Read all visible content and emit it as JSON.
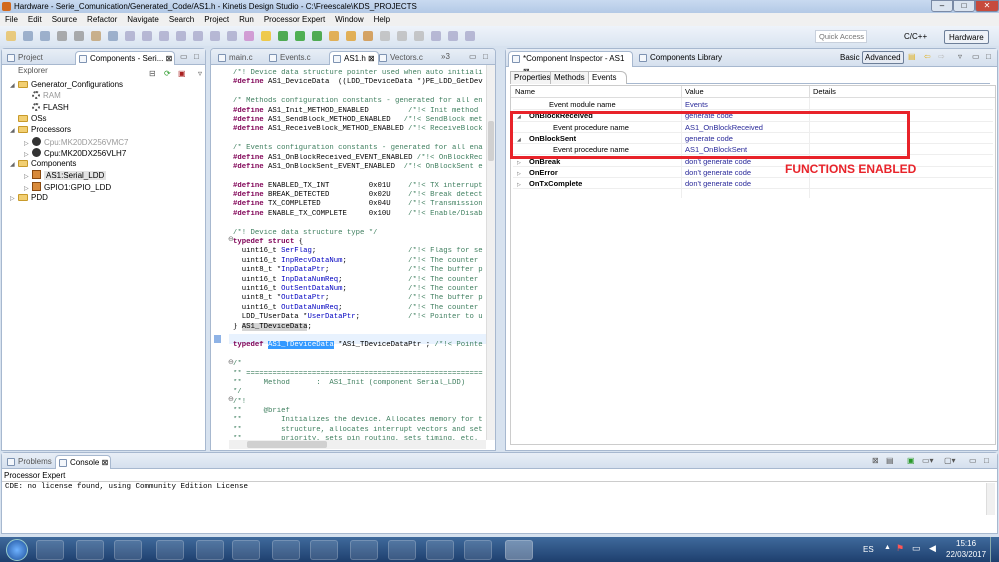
{
  "window": {
    "title": "Hardware - Serie_Comunication/Generated_Code/AS1.h - Kinetis Design Studio - C:\\Freescale\\KDS_PROJECTS",
    "minimize": "–",
    "maximize": "□",
    "close": "✕"
  },
  "menu": [
    "File",
    "Edit",
    "Source",
    "Refactor",
    "Navigate",
    "Search",
    "Project",
    "Run",
    "Processor Expert",
    "Window",
    "Help"
  ],
  "toolbar": {
    "quick_access_placeholder": "Quick Access",
    "perspectives": [
      "C/C++",
      "Hardware"
    ]
  },
  "left_panel": {
    "tabs": [
      "Project Explorer",
      "Components - Seri..."
    ],
    "tree": [
      {
        "label": "Generator_Configurations",
        "icon": "folder-icon",
        "expanded": true,
        "depth": 0
      },
      {
        "label": "RAM",
        "icon": "gear-icon",
        "depth": 1,
        "dim": true
      },
      {
        "label": "FLASH",
        "icon": "gear-icon",
        "depth": 1
      },
      {
        "label": "OSs",
        "icon": "folder-icon",
        "depth": 0
      },
      {
        "label": "Processors",
        "icon": "folder-icon",
        "expanded": true,
        "depth": 0
      },
      {
        "label": "Cpu:MK20DX256VMC7",
        "icon": "chip-icon",
        "depth": 1,
        "dim": true,
        "collapsed": true
      },
      {
        "label": "Cpu:MK20DX256VLH7",
        "icon": "chip-icon",
        "depth": 1,
        "collapsed": true
      },
      {
        "label": "Components",
        "icon": "folder-icon",
        "expanded": true,
        "depth": 0
      },
      {
        "label": "AS1:Serial_LDD",
        "icon": "component-icon",
        "depth": 1,
        "collapsed": true,
        "selected": true
      },
      {
        "label": "GPIO1:GPIO_LDD",
        "icon": "component-icon",
        "depth": 1,
        "collapsed": true
      },
      {
        "label": "PDD",
        "icon": "folder-icon",
        "depth": 0,
        "collapsed": true
      }
    ]
  },
  "editor": {
    "tabs": [
      "main.c",
      "Events.c",
      "AS1.h",
      "Vectors.c"
    ],
    "active_tab": "AS1.h",
    "overflow": "»3",
    "lines": [
      "/*! Device data structure pointer used when auto initiali",
      "#define AS1_DeviceData  ((LDD_TDeviceData *)PE_LDD_GetDev",
      "",
      "/* Methods configuration constants - generated for all en",
      "#define AS1_Init_METHOD_ENABLED         /*!< Init method o",
      "#define AS1_SendBlock_METHOD_ENABLED   /*!< SendBlock met",
      "#define AS1_ReceiveBlock_METHOD_ENABLED /*!< ReceiveBlock",
      "",
      "/* Events configuration constants - generated for all ena",
      "#define AS1_OnBlockReceived_EVENT_ENABLED /*!< OnBlockRec",
      "#define AS1_OnBlockSent_EVENT_ENABLED  /*!< OnBlockSent e",
      "",
      "#define ENABLED_TX_INT         0x01U    /*!< TX interrupt",
      "#define BREAK_DETECTED         0x02U    /*!< Break detecte",
      "#define TX_COMPLETED           0x04U    /*!< Transmission",
      "#define ENABLE_TX_COMPLETE     0x10U    /*!< Enable/Disabl",
      "",
      "/*! Device data structure type */",
      "typedef struct {",
      "  uint16_t SerFlag;                     /*!< Flags for ser",
      "  uint16_t InpRecvDataNum;              /*!< The counter o",
      "  uint8_t *InpDataPtr;                  /*!< The buffer po",
      "  uint16_t InpDataNumReq;               /*!< The counter o",
      "  uint16_t OutSentDataNum;              /*!< The counter o",
      "  uint8_t *OutDataPtr;                  /*!< The buffer po",
      "  uint16_t OutDataNumReq;               /*!< The counter o",
      "  LDD_TUserData *UserDataPtr;           /*!< Pointer to us",
      "} AS1_TDeviceData;",
      "",
      "typedef AS1_TDeviceData *AS1_TDeviceDataPtr ; /*!< Pointe",
      "",
      "/*",
      "** ===========================================================",
      "**     Method      :  AS1_Init (component Serial_LDD)",
      "*/",
      "/*!",
      "**     @brief",
      "**         Initializes the device. Allocates memory for t",
      "**         structure, allocates interrupt vectors and set",
      "**         priority, sets pin routing, sets timing, etc."
    ]
  },
  "inspector": {
    "tabs": [
      "*Component Inspector - AS1",
      "Components Library"
    ],
    "modes": [
      "Basic",
      "Advanced"
    ],
    "subtabs": [
      "Properties",
      "Methods",
      "Events"
    ],
    "active_subtab": "Events",
    "columns": [
      "Name",
      "Value",
      "Details"
    ],
    "rows": [
      {
        "name": "Event module name",
        "value": "Events",
        "bold": false,
        "indent": true,
        "toggle": ""
      },
      {
        "name": "OnBlockReceived",
        "value": "generate code",
        "bold": true,
        "toggle": "◢"
      },
      {
        "name": "Event procedure name",
        "value": "AS1_OnBlockReceived",
        "indent2": true,
        "toggle": ""
      },
      {
        "name": "OnBlockSent",
        "value": "generate code",
        "bold": true,
        "toggle": "◢"
      },
      {
        "name": "Event procedure name",
        "value": "AS1_OnBlockSent",
        "indent2": true,
        "toggle": ""
      },
      {
        "name": "OnBreak",
        "value": "don't generate code",
        "bold": true,
        "toggle": "▷"
      },
      {
        "name": "OnError",
        "value": "don't generate code",
        "bold": true,
        "toggle": "▷"
      },
      {
        "name": "OnTxComplete",
        "value": "don't generate code",
        "bold": true,
        "toggle": "▷"
      }
    ],
    "annotation": "FUNCTIONS ENABLED",
    "annotation_color": "#e8232a"
  },
  "console": {
    "tabs": [
      "Problems",
      "Console"
    ],
    "active_tab": "Console",
    "header": "Processor Expert",
    "output": "CDE: no license found, using Community Edition License"
  },
  "taskbar": {
    "language": "ES",
    "time": "15:16",
    "date": "22/03/2017"
  }
}
